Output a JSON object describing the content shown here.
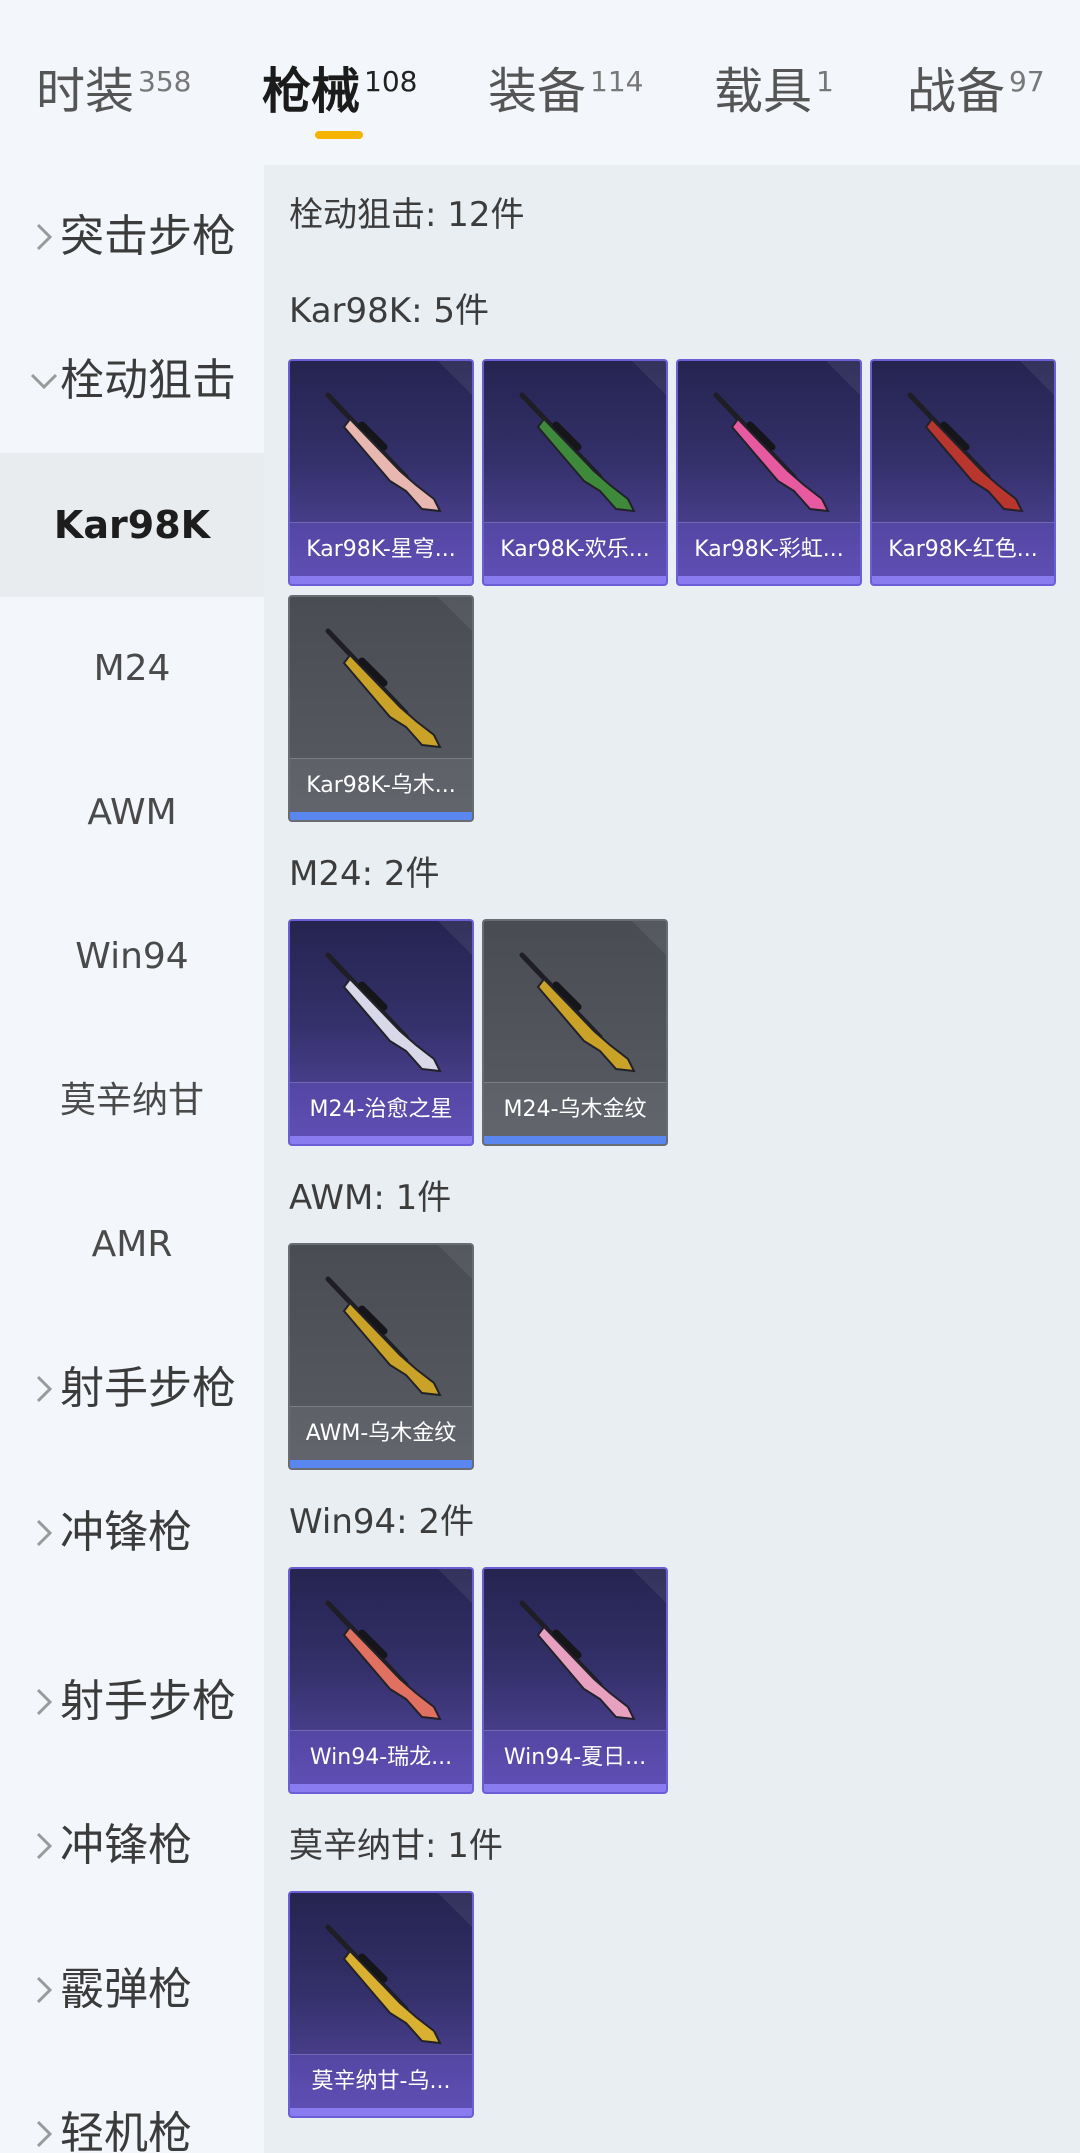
{
  "tabs": [
    {
      "label": "时装",
      "count": "358"
    },
    {
      "label": "枪械",
      "count": "108",
      "active": true
    },
    {
      "label": "装备",
      "count": "114"
    },
    {
      "label": "载具",
      "count": "1"
    },
    {
      "label": "战备",
      "count": "97"
    }
  ],
  "sidebar": {
    "items": [
      {
        "label": "突击步枪",
        "type": "group",
        "expanded": false
      },
      {
        "label": "栓动狙击",
        "type": "group",
        "expanded": true
      },
      {
        "label": "Kar98K",
        "type": "sub",
        "active": true
      },
      {
        "label": "M24",
        "type": "sub"
      },
      {
        "label": "AWM",
        "type": "sub"
      },
      {
        "label": "Win94",
        "type": "sub"
      },
      {
        "label": "莫辛纳甘",
        "type": "sub"
      },
      {
        "label": "AMR",
        "type": "sub"
      },
      {
        "label": "射手步枪",
        "type": "group",
        "expanded": false
      },
      {
        "label": "冲锋枪",
        "type": "group",
        "expanded": false
      },
      {
        "label": "射手步枪",
        "type": "group",
        "expanded": false
      },
      {
        "label": "冲锋枪",
        "type": "group",
        "expanded": false
      },
      {
        "label": "霰弹枪",
        "type": "group",
        "expanded": false
      },
      {
        "label": "轻机枪",
        "type": "group",
        "expanded": false
      }
    ]
  },
  "main": {
    "category_title": "栓动狙击: 12件",
    "groups": [
      {
        "title": "Kar98K: 5件",
        "items": [
          {
            "name": "Kar98K-星穹...",
            "rarity": "purple",
            "gun_color": "#e8b8b0"
          },
          {
            "name": "Kar98K-欢乐...",
            "rarity": "purple",
            "gun_color": "#3f8a3a"
          },
          {
            "name": "Kar98K-彩虹...",
            "rarity": "purple",
            "gun_color": "#e85aa0"
          },
          {
            "name": "Kar98K-红色...",
            "rarity": "purple",
            "gun_color": "#b8362e"
          },
          {
            "name": "Kar98K-乌木...",
            "rarity": "gray",
            "gun_color": "#c9a227"
          }
        ]
      },
      {
        "title": "M24: 2件",
        "items": [
          {
            "name": "M24-治愈之星",
            "rarity": "purple",
            "gun_color": "#d8d8e8"
          },
          {
            "name": "M24-乌木金纹",
            "rarity": "gray",
            "gun_color": "#c9a227"
          }
        ]
      },
      {
        "title": "AWM: 1件",
        "items": [
          {
            "name": "AWM-乌木金纹",
            "rarity": "gray",
            "gun_color": "#c9a227"
          }
        ]
      },
      {
        "title": "Win94: 2件",
        "items": [
          {
            "name": "Win94-瑞龙...",
            "rarity": "purple",
            "gun_color": "#e07060"
          },
          {
            "name": "Win94-夏日...",
            "rarity": "purple",
            "gun_color": "#e8a0c0"
          }
        ]
      },
      {
        "title": "莫辛纳甘: 1件",
        "items": [
          {
            "name": "莫辛纳甘-乌...",
            "rarity": "purple",
            "gun_color": "#d9b030"
          }
        ]
      }
    ]
  },
  "colors": {
    "tab_indicator": "#f5b400",
    "purple_bar": "#8a7cf0",
    "gray_bar": "#5a86f0"
  }
}
